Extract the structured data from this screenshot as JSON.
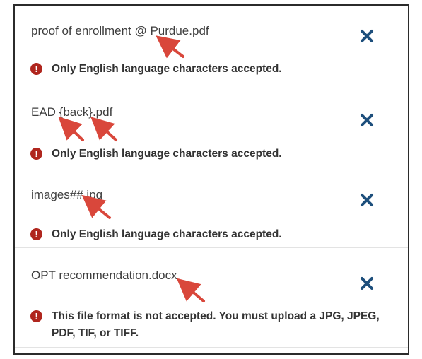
{
  "files": [
    {
      "name": "proof of enrollment @ Purdue.pdf",
      "error": "Only English language characters accepted.",
      "remove_icon": "close-icon",
      "error_icon": "exclamation-circle-icon"
    },
    {
      "name": "EAD {back}.pdf",
      "error": "Only English language characters accepted.",
      "remove_icon": "close-icon",
      "error_icon": "exclamation-circle-icon"
    },
    {
      "name": "images##.jpg",
      "error": "Only English language characters accepted.",
      "remove_icon": "close-icon",
      "error_icon": "exclamation-circle-icon"
    },
    {
      "name": "OPT recommendation.docx",
      "error": "This file format is not accepted. You must upload a JPG, JPEG, PDF, TIF, or TIFF.",
      "remove_icon": "close-icon",
      "error_icon": "exclamation-circle-icon"
    }
  ],
  "colors": {
    "remove_icon": "#1d4f7c",
    "error_icon_bg": "#b0261e",
    "annotation_arrow": "#d9473b",
    "text": "#3e3e3e"
  }
}
